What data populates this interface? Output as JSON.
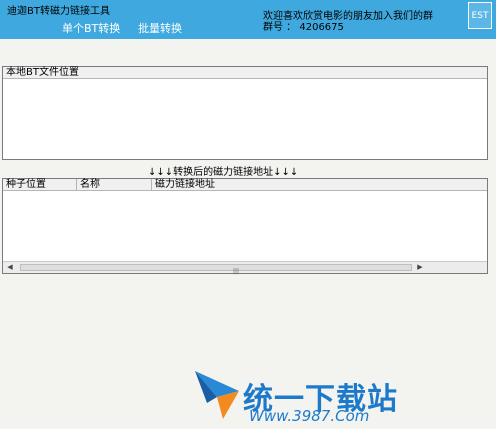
{
  "app": {
    "title": "迪迦BT转磁力链接工具",
    "tabs": [
      {
        "label": "单个BT转换"
      },
      {
        "label": "批量转换"
      }
    ],
    "promo_line1": "欢迎喜欢欣赏电影的朋友加入我们的群",
    "promo_line2": "群号 ： 4206675",
    "exit_button": "EST"
  },
  "top_panel": {
    "header": "本地BT文件位置"
  },
  "middle_label": "↓↓↓转换后的磁力链接地址↓↓↓",
  "bottom_panel": {
    "columns": [
      "种子位置",
      "名称",
      "磁力链接地址"
    ]
  },
  "watermark": {
    "brand": "统一下载站",
    "url": "Www.3987.Com"
  }
}
